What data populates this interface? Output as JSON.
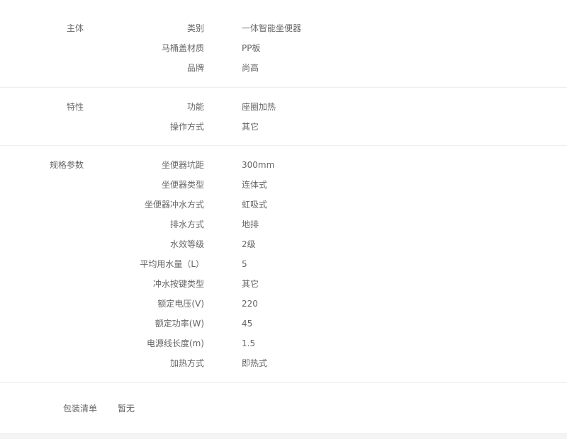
{
  "groups": [
    {
      "title": "主体",
      "rows": [
        {
          "label": "类别",
          "value": "一体智能坐便器"
        },
        {
          "label": "马桶盖材质",
          "value": "PP板"
        },
        {
          "label": "品牌",
          "value": "尚高"
        }
      ]
    },
    {
      "title": "特性",
      "rows": [
        {
          "label": "功能",
          "value": "座圈加热"
        },
        {
          "label": "操作方式",
          "value": "其它"
        }
      ]
    },
    {
      "title": "规格参数",
      "rows": [
        {
          "label": "坐便器坑距",
          "value": "300mm"
        },
        {
          "label": "坐便器类型",
          "value": "连体式"
        },
        {
          "label": "坐便器冲水方式",
          "value": "虹吸式"
        },
        {
          "label": "排水方式",
          "value": "地排"
        },
        {
          "label": "水效等级",
          "value": "2级"
        },
        {
          "label": "平均用水量（L）",
          "value": "5"
        },
        {
          "label": "冲水按键类型",
          "value": "其它"
        },
        {
          "label": "额定电压(V)",
          "value": "220"
        },
        {
          "label": "额定功率(W)",
          "value": "45"
        },
        {
          "label": "电源线长度(m)",
          "value": "1.5"
        },
        {
          "label": "加热方式",
          "value": "即热式"
        }
      ]
    }
  ],
  "package": {
    "label": "包装清单",
    "value": "暂无"
  }
}
